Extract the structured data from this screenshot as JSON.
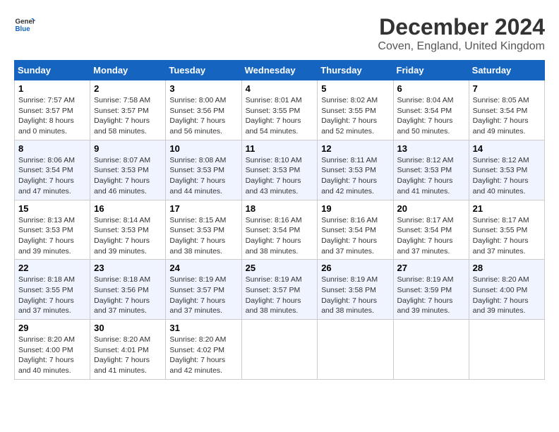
{
  "header": {
    "logo_line1": "General",
    "logo_line2": "Blue",
    "month": "December 2024",
    "location": "Coven, England, United Kingdom"
  },
  "weekdays": [
    "Sunday",
    "Monday",
    "Tuesday",
    "Wednesday",
    "Thursday",
    "Friday",
    "Saturday"
  ],
  "weeks": [
    [
      {
        "day": "1",
        "sunrise": "Sunrise: 7:57 AM",
        "sunset": "Sunset: 3:57 PM",
        "daylight": "Daylight: 8 hours and 0 minutes."
      },
      {
        "day": "2",
        "sunrise": "Sunrise: 7:58 AM",
        "sunset": "Sunset: 3:57 PM",
        "daylight": "Daylight: 7 hours and 58 minutes."
      },
      {
        "day": "3",
        "sunrise": "Sunrise: 8:00 AM",
        "sunset": "Sunset: 3:56 PM",
        "daylight": "Daylight: 7 hours and 56 minutes."
      },
      {
        "day": "4",
        "sunrise": "Sunrise: 8:01 AM",
        "sunset": "Sunset: 3:55 PM",
        "daylight": "Daylight: 7 hours and 54 minutes."
      },
      {
        "day": "5",
        "sunrise": "Sunrise: 8:02 AM",
        "sunset": "Sunset: 3:55 PM",
        "daylight": "Daylight: 7 hours and 52 minutes."
      },
      {
        "day": "6",
        "sunrise": "Sunrise: 8:04 AM",
        "sunset": "Sunset: 3:54 PM",
        "daylight": "Daylight: 7 hours and 50 minutes."
      },
      {
        "day": "7",
        "sunrise": "Sunrise: 8:05 AM",
        "sunset": "Sunset: 3:54 PM",
        "daylight": "Daylight: 7 hours and 49 minutes."
      }
    ],
    [
      {
        "day": "8",
        "sunrise": "Sunrise: 8:06 AM",
        "sunset": "Sunset: 3:54 PM",
        "daylight": "Daylight: 7 hours and 47 minutes."
      },
      {
        "day": "9",
        "sunrise": "Sunrise: 8:07 AM",
        "sunset": "Sunset: 3:53 PM",
        "daylight": "Daylight: 7 hours and 46 minutes."
      },
      {
        "day": "10",
        "sunrise": "Sunrise: 8:08 AM",
        "sunset": "Sunset: 3:53 PM",
        "daylight": "Daylight: 7 hours and 44 minutes."
      },
      {
        "day": "11",
        "sunrise": "Sunrise: 8:10 AM",
        "sunset": "Sunset: 3:53 PM",
        "daylight": "Daylight: 7 hours and 43 minutes."
      },
      {
        "day": "12",
        "sunrise": "Sunrise: 8:11 AM",
        "sunset": "Sunset: 3:53 PM",
        "daylight": "Daylight: 7 hours and 42 minutes."
      },
      {
        "day": "13",
        "sunrise": "Sunrise: 8:12 AM",
        "sunset": "Sunset: 3:53 PM",
        "daylight": "Daylight: 7 hours and 41 minutes."
      },
      {
        "day": "14",
        "sunrise": "Sunrise: 8:12 AM",
        "sunset": "Sunset: 3:53 PM",
        "daylight": "Daylight: 7 hours and 40 minutes."
      }
    ],
    [
      {
        "day": "15",
        "sunrise": "Sunrise: 8:13 AM",
        "sunset": "Sunset: 3:53 PM",
        "daylight": "Daylight: 7 hours and 39 minutes."
      },
      {
        "day": "16",
        "sunrise": "Sunrise: 8:14 AM",
        "sunset": "Sunset: 3:53 PM",
        "daylight": "Daylight: 7 hours and 39 minutes."
      },
      {
        "day": "17",
        "sunrise": "Sunrise: 8:15 AM",
        "sunset": "Sunset: 3:53 PM",
        "daylight": "Daylight: 7 hours and 38 minutes."
      },
      {
        "day": "18",
        "sunrise": "Sunrise: 8:16 AM",
        "sunset": "Sunset: 3:54 PM",
        "daylight": "Daylight: 7 hours and 38 minutes."
      },
      {
        "day": "19",
        "sunrise": "Sunrise: 8:16 AM",
        "sunset": "Sunset: 3:54 PM",
        "daylight": "Daylight: 7 hours and 37 minutes."
      },
      {
        "day": "20",
        "sunrise": "Sunrise: 8:17 AM",
        "sunset": "Sunset: 3:54 PM",
        "daylight": "Daylight: 7 hours and 37 minutes."
      },
      {
        "day": "21",
        "sunrise": "Sunrise: 8:17 AM",
        "sunset": "Sunset: 3:55 PM",
        "daylight": "Daylight: 7 hours and 37 minutes."
      }
    ],
    [
      {
        "day": "22",
        "sunrise": "Sunrise: 8:18 AM",
        "sunset": "Sunset: 3:55 PM",
        "daylight": "Daylight: 7 hours and 37 minutes."
      },
      {
        "day": "23",
        "sunrise": "Sunrise: 8:18 AM",
        "sunset": "Sunset: 3:56 PM",
        "daylight": "Daylight: 7 hours and 37 minutes."
      },
      {
        "day": "24",
        "sunrise": "Sunrise: 8:19 AM",
        "sunset": "Sunset: 3:57 PM",
        "daylight": "Daylight: 7 hours and 37 minutes."
      },
      {
        "day": "25",
        "sunrise": "Sunrise: 8:19 AM",
        "sunset": "Sunset: 3:57 PM",
        "daylight": "Daylight: 7 hours and 38 minutes."
      },
      {
        "day": "26",
        "sunrise": "Sunrise: 8:19 AM",
        "sunset": "Sunset: 3:58 PM",
        "daylight": "Daylight: 7 hours and 38 minutes."
      },
      {
        "day": "27",
        "sunrise": "Sunrise: 8:19 AM",
        "sunset": "Sunset: 3:59 PM",
        "daylight": "Daylight: 7 hours and 39 minutes."
      },
      {
        "day": "28",
        "sunrise": "Sunrise: 8:20 AM",
        "sunset": "Sunset: 4:00 PM",
        "daylight": "Daylight: 7 hours and 39 minutes."
      }
    ],
    [
      {
        "day": "29",
        "sunrise": "Sunrise: 8:20 AM",
        "sunset": "Sunset: 4:00 PM",
        "daylight": "Daylight: 7 hours and 40 minutes."
      },
      {
        "day": "30",
        "sunrise": "Sunrise: 8:20 AM",
        "sunset": "Sunset: 4:01 PM",
        "daylight": "Daylight: 7 hours and 41 minutes."
      },
      {
        "day": "31",
        "sunrise": "Sunrise: 8:20 AM",
        "sunset": "Sunset: 4:02 PM",
        "daylight": "Daylight: 7 hours and 42 minutes."
      },
      null,
      null,
      null,
      null
    ]
  ]
}
